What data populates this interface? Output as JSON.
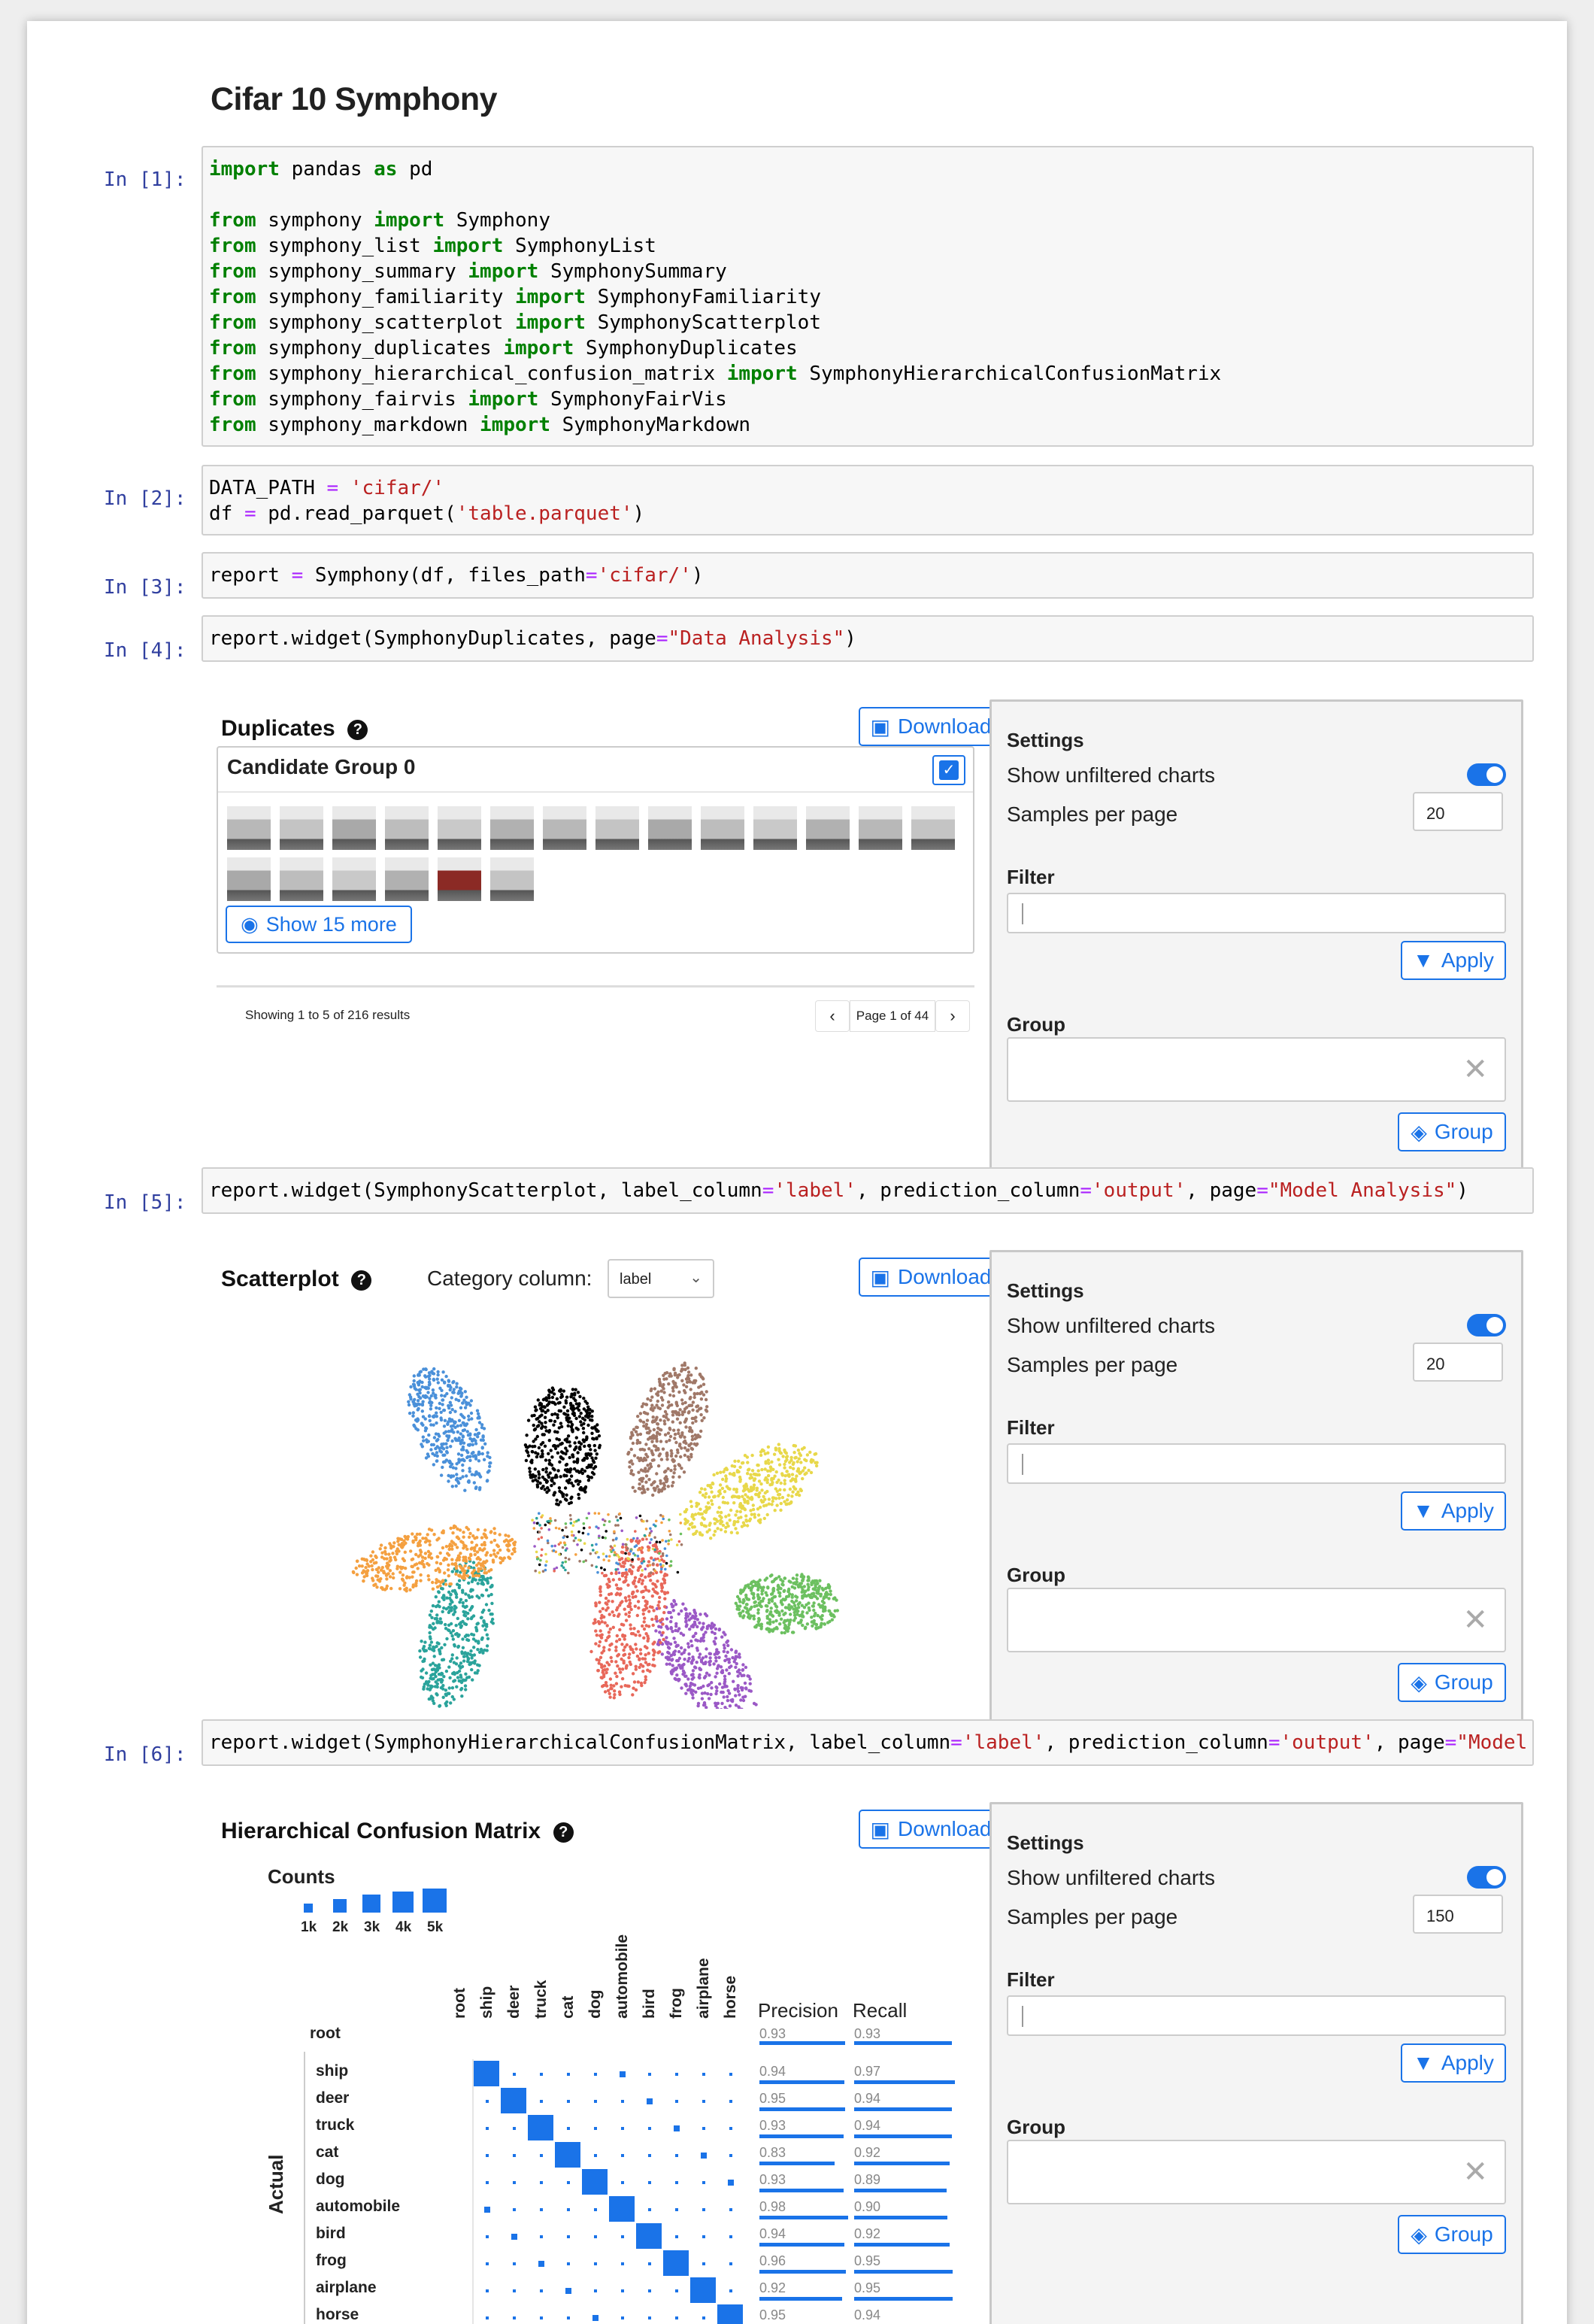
{
  "notebook": {
    "title": "Cifar 10 Symphony"
  },
  "cells": [
    {
      "prompt": "In [1]:"
    },
    {
      "prompt": "In [2]:"
    },
    {
      "prompt": "In [3]:"
    },
    {
      "prompt": "In [4]:"
    },
    {
      "prompt": "In [5]:"
    },
    {
      "prompt": "In [6]:"
    }
  ],
  "duplicates": {
    "title": "Duplicates",
    "download": "Download",
    "group_title": "Candidate Group 0",
    "show_more": "Show 15 more",
    "showing": "Showing 1 to 5 of 216 results",
    "page": "Page 1 of 44"
  },
  "scatter": {
    "title": "Scatterplot",
    "category_label": "Category column:",
    "category_value": "label",
    "download": "Download"
  },
  "hcm": {
    "title": "Hierarchical Confusion Matrix",
    "download": "Download",
    "counts": "Counts",
    "legend": [
      "1k",
      "2k",
      "3k",
      "4k",
      "5k"
    ],
    "root": "root",
    "actual": "Actual",
    "precision": "Precision",
    "recall": "Recall",
    "classes": [
      "ship",
      "deer",
      "truck",
      "cat",
      "dog",
      "automobile",
      "bird",
      "frog",
      "airplane",
      "horse"
    ],
    "root_precision": "0.93",
    "root_recall": "0.93",
    "precision_values": [
      "0.94",
      "0.95",
      "0.93",
      "0.83",
      "0.93",
      "0.98",
      "0.94",
      "0.96",
      "0.92",
      "0.95"
    ],
    "recall_values": [
      "0.97",
      "0.94",
      "0.94",
      "0.92",
      "0.89",
      "0.90",
      "0.92",
      "0.95",
      "0.95",
      "0.94"
    ]
  },
  "settings": [
    {
      "title": "Settings",
      "unfiltered": "Show unfiltered charts",
      "samples": "Samples per page",
      "samples_value": "20",
      "filter": "Filter",
      "apply": "Apply",
      "group": "Group",
      "group_btn": "Group"
    },
    {
      "title": "Settings",
      "unfiltered": "Show unfiltered charts",
      "samples": "Samples per page",
      "samples_value": "20",
      "filter": "Filter",
      "apply": "Apply",
      "group": "Group",
      "group_btn": "Group"
    },
    {
      "title": "Settings",
      "unfiltered": "Show unfiltered charts",
      "samples": "Samples per page",
      "samples_value": "150",
      "filter": "Filter",
      "apply": "Apply",
      "group": "Group",
      "group_btn": "Group"
    }
  ],
  "colors": {
    "accent": "#1a73e8",
    "scatter": [
      "#4a90d9",
      "#000000",
      "#a07868",
      "#e8d84a",
      "#6cc060",
      "#9b59c6",
      "#e8685a",
      "#2aa39b",
      "#f4a040"
    ]
  }
}
